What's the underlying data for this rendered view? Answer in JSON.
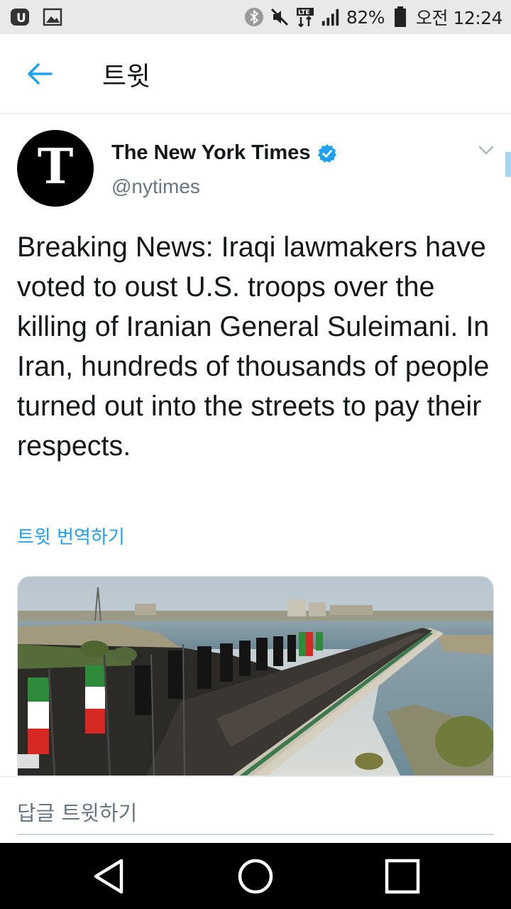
{
  "status_bar": {
    "battery_percent": "82%",
    "time": "오전 12:24",
    "network": "LTE"
  },
  "header": {
    "title": "트윗"
  },
  "tweet": {
    "author_name": "The New York Times",
    "handle": "@nytimes",
    "avatar_letter": "T",
    "text": "Breaking News: Iraqi lawmakers have voted to oust U.S. troops over the killing of Iranian General Suleimani. In Iran, hundreds of thousands of people turned out into the streets to pay their respects.",
    "translate_label": "트윗 번역하기"
  },
  "reply": {
    "placeholder": "답글 트윗하기"
  },
  "colors": {
    "accent": "#1da1f2",
    "muted": "#657786",
    "navbar": "#000000"
  }
}
